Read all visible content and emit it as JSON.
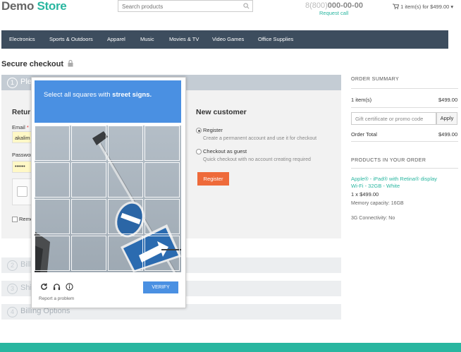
{
  "header": {
    "logo_part1": "Demo",
    "logo_part2": "Store",
    "search_placeholder": "Search products",
    "phone_prefix": "8(800)",
    "phone_number": "000-00-00",
    "request_call": "Request call",
    "cart": "1 item(s) for $499.00"
  },
  "nav": [
    "Electronics",
    "Sports & Outdoors",
    "Apparel",
    "Music",
    "Movies & TV",
    "Video Games",
    "Office Supplies"
  ],
  "checkout": {
    "title": "Secure checkout",
    "step1_num": "1",
    "step1_label": "Ple",
    "returning_title": "Retur",
    "email_label": "Email",
    "email_required": "*",
    "email_value": "akalim",
    "password_label": "Passwor",
    "password_value": "••••••",
    "remember_label": "Reme",
    "new_customer_title": "New customer",
    "register_label": "Register",
    "register_hint": "Create a permanent account and use it for checkout",
    "guest_label": "Checkout as guest",
    "guest_hint": "Quick checkout with no account creating required",
    "register_button": "Register",
    "steps": [
      {
        "num": "2",
        "label": "Bill"
      },
      {
        "num": "3",
        "label": "Shi"
      },
      {
        "num": "4",
        "label": "Billing Options"
      }
    ]
  },
  "summary": {
    "title": "ORDER SUMMARY",
    "items_label": "1 item(s)",
    "items_price": "$499.00",
    "promo_placeholder": "Gift certificate or promo code",
    "apply_label": "Apply",
    "total_label": "Order Total",
    "total_price": "$499.00",
    "products_title": "PRODUCTS IN YOUR ORDER",
    "product_line1": "Apple® - iPad® with Retina® display",
    "product_line2": "Wi-Fi - 32GB - White",
    "qty_price": "1 x $499.00",
    "option1": "Memory capacity: 16GB",
    "option2": "3G Connectivity: No"
  },
  "captcha": {
    "instruction_prefix": "Select all squares with",
    "instruction_target": "street signs.",
    "verify_label": "VERIFY",
    "report_label": "Report a problem"
  },
  "colors": {
    "accent": "#29b6a0",
    "nav_bg": "#3d4d5e",
    "captcha_blue": "#4a90e2",
    "register_orange": "#ee6a3a"
  }
}
